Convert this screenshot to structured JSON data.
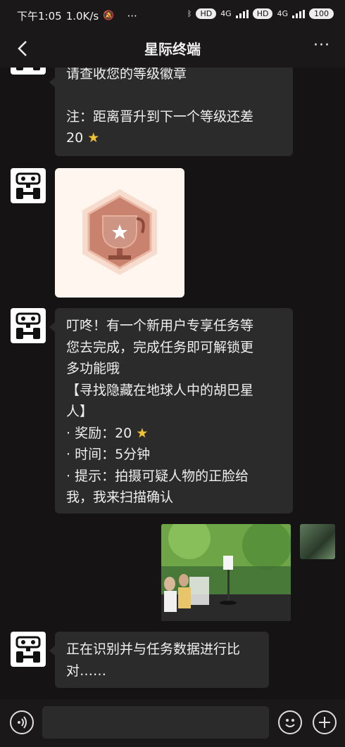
{
  "status": {
    "time": "下午1:05",
    "speed": "1.0K/s",
    "more": "···",
    "net1": "4G",
    "net2": "4G",
    "hd1": "HD",
    "hd2": "HD",
    "battery": "100"
  },
  "header": {
    "title": "星际终端",
    "more": "···"
  },
  "messages": {
    "m1_l1": "请查收您的等级徽章",
    "m1_l2": "注：距离晋升到下一个等级还差",
    "m1_l3": "20",
    "m3_l1": "叮咚！有一个新用户专享任务等",
    "m3_l2": "您去完成，完成任务即可解锁更",
    "m3_l3": "多功能哦",
    "m3_l4": "【寻找隐藏在地球人中的胡巴星",
    "m3_l5": "人】",
    "m3_l6": "· 奖励：20",
    "m3_l7": "· 时间：5分钟",
    "m3_l8": "· 提示：拍摄可疑人物的正脸给",
    "m3_l9": "我，我来扫描确认",
    "m5_l1": "正在识别并与任务数据进行比",
    "m5_l2": "对……"
  },
  "icons": {
    "star": "★"
  },
  "colors": {
    "background": "#151313",
    "bubble": "#2b2b2b",
    "badge": "#c9826d",
    "star": "#f2c235"
  }
}
